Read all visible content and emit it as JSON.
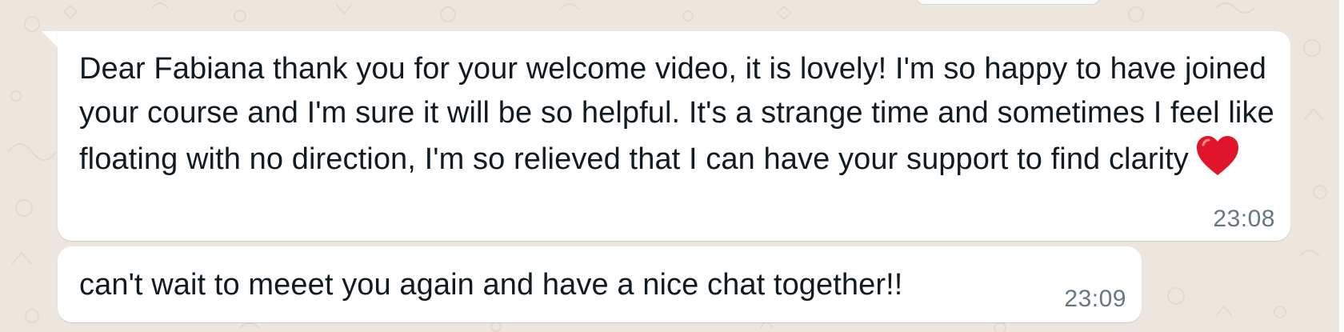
{
  "messages": [
    {
      "text": "Dear Fabiana thank you for your welcome video, it is lovely! I'm so happy to have joined your course and I'm sure it will be so helpful. It's a strange time and sometimes I feel like floating with no direction, I'm so relieved that I can have your support to find clarity",
      "emoji": "heart-emoji",
      "time": "23:08"
    },
    {
      "text": "can't wait to meeet you again and have a nice chat together!!",
      "time": "23:09"
    }
  ],
  "colors": {
    "bubble": "#ffffff",
    "background": "#efe7df",
    "text": "#111b21",
    "timestamp": "#667781",
    "heart": "#e0142a"
  }
}
